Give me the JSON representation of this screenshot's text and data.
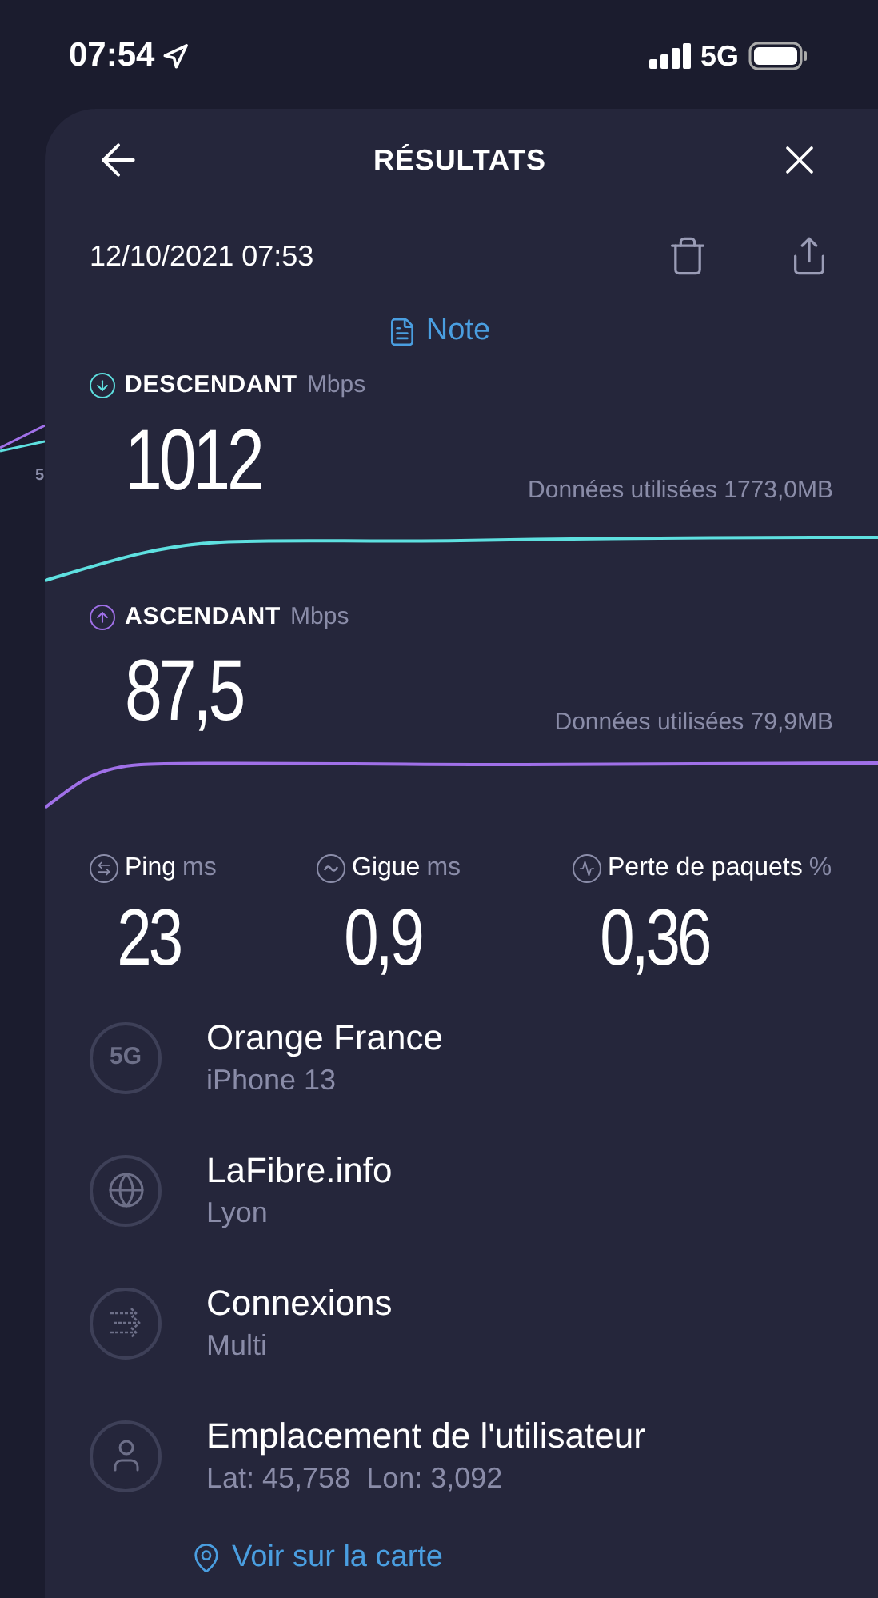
{
  "status_bar": {
    "time": "07:54",
    "network": "5G"
  },
  "background_chart": {
    "tick": "5"
  },
  "header": {
    "title": "RÉSULTATS"
  },
  "date": "12/10/2021 07:53",
  "note_link": "Note",
  "speeds": [
    {
      "kind": "download",
      "label": "DESCENDANT",
      "unit": "Mbps",
      "value": "1012",
      "data_used": "Données utilisées 1773,0MB",
      "color": "#5ee0e0"
    },
    {
      "kind": "upload",
      "label": "ASCENDANT",
      "unit": "Mbps",
      "value": "87,5",
      "data_used": "Données utilisées 79,9MB",
      "color": "#a070e8"
    }
  ],
  "stats": [
    {
      "kind": "ping",
      "label": "Ping",
      "unit": "ms",
      "value": "23"
    },
    {
      "kind": "jitter",
      "label": "Gigue",
      "unit": "ms",
      "value": "0,9"
    },
    {
      "kind": "loss",
      "label": "Perte de paquets",
      "unit": "%",
      "value": "0,36"
    }
  ],
  "details": [
    {
      "kind": "network",
      "badge": "5G",
      "title": "Orange France",
      "subtitle": "iPhone 13"
    },
    {
      "kind": "server",
      "title": "LaFibre.info",
      "subtitle": "Lyon"
    },
    {
      "kind": "connections",
      "title": "Connexions",
      "subtitle": "Multi"
    },
    {
      "kind": "location",
      "title": "Emplacement de l'utilisateur",
      "subtitle": "Lat: 45,758  Lon: 3,092"
    }
  ],
  "map_link": "Voir sur la carte"
}
